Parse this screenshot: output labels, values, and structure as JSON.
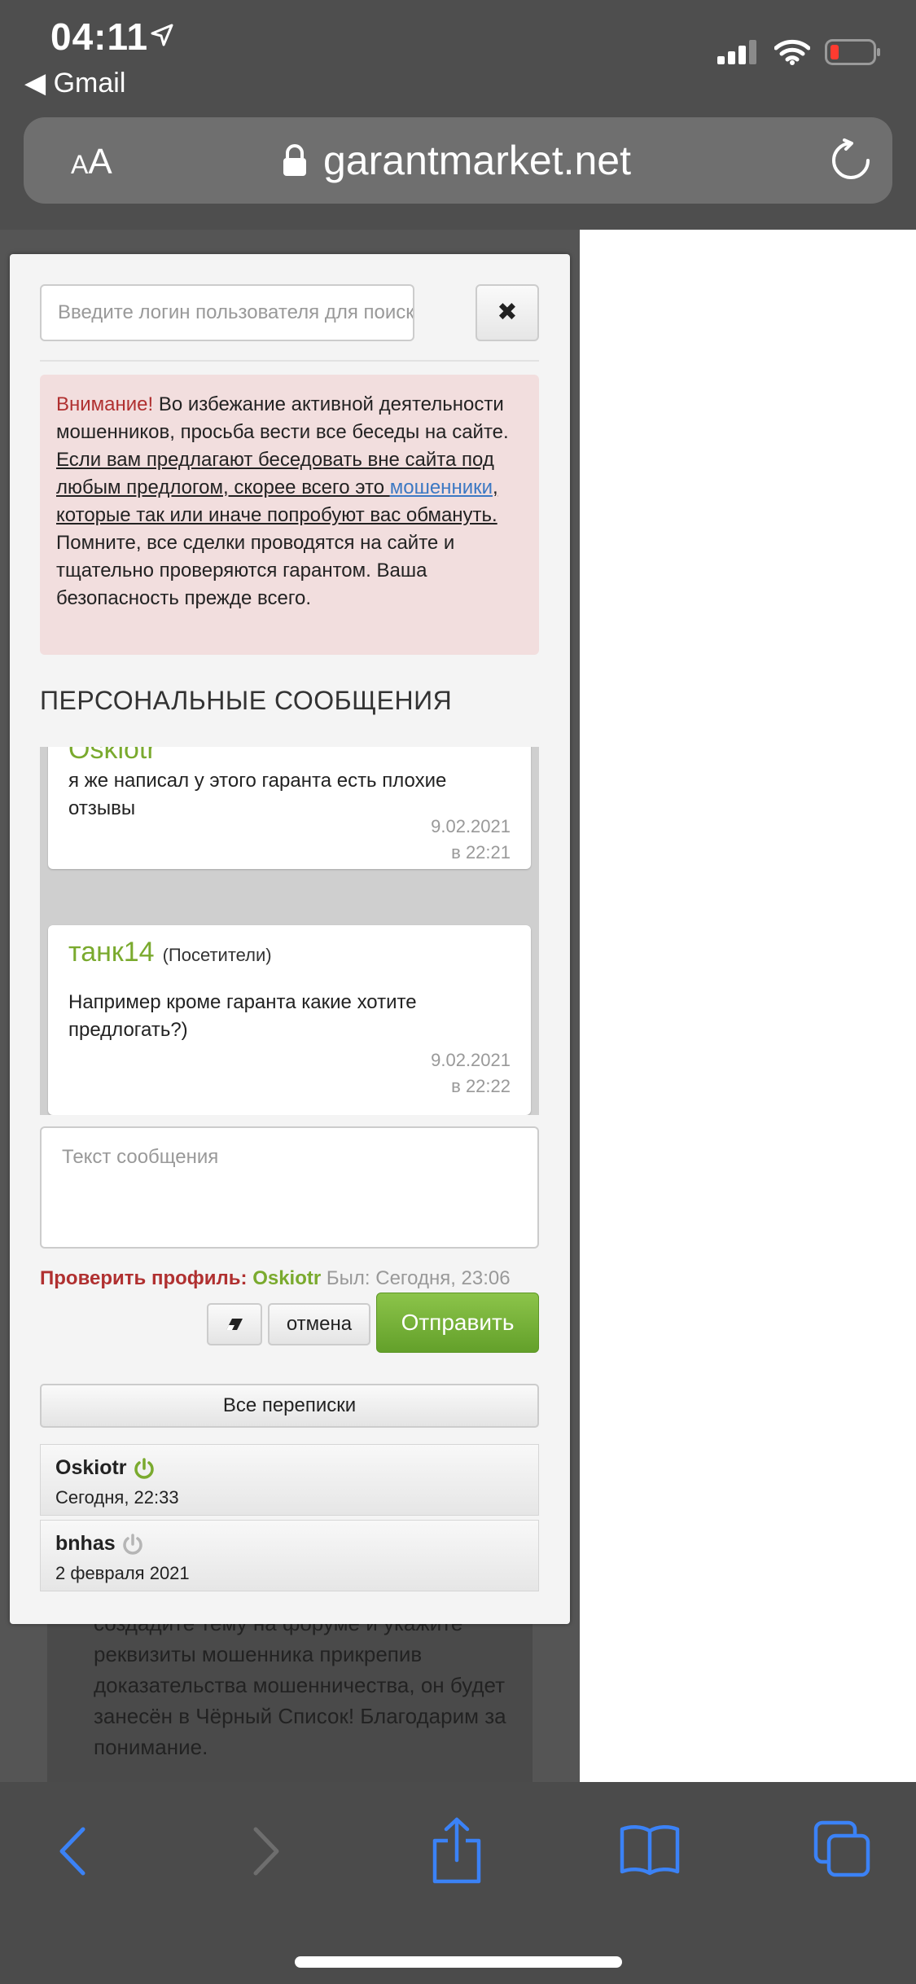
{
  "status_bar": {
    "time": "04:11",
    "back_app": "◀ Gmail"
  },
  "url_bar": {
    "text_size_label": "AA",
    "domain": "garantmarket.net"
  },
  "modal": {
    "search_placeholder": "Введите логин пользователя для поиска",
    "close_label": "✖",
    "alert": {
      "warning_word": "Внимание!",
      "part1": " Во избежание активной деятельности мошенников, просьба вести все беседы на сайте. ",
      "underlined1": "Если вам предлагают беседовать вне сайта под любым предлогом, скорее всего это ",
      "link": "мошенники",
      "underlined2": ", которые так или иначе попробуют вас обмануть.",
      "part2": " Помните, все сделки проводятся на сайте и тщательно проверяются гарантом. Ваша безопасность прежде всего."
    },
    "pm_title": "ПЕРСОНАЛЬНЫЕ СООБЩЕНИЯ",
    "messages": [
      {
        "author": "Oskiotr",
        "text": "я же написал у этого гаранта есть плохие отзывы",
        "date": "9.02.2021",
        "time": "в 22:21"
      },
      {
        "author": "танк14",
        "role": "(Посетители)",
        "text": "Например кроме гаранта какие хотите предлогать?)",
        "date": "9.02.2021",
        "time": "в 22:22"
      }
    ],
    "message_placeholder": "Текст сообщения",
    "profile": {
      "label": "Проверить профиль:",
      "nick": "Oskiotr",
      "seen": "Был: Сегодня, 23:06"
    },
    "buttons": {
      "cancel": "отмена",
      "send": "Отправить",
      "all_chats": "Все переписки"
    },
    "conversations": [
      {
        "name": "Oskiotr",
        "date": "Сегодня, 22:33",
        "online": true
      },
      {
        "name": "bnhas",
        "date": "2 февраля 2021",
        "online": false
      }
    ]
  },
  "background_text": "создадите тему на форуме и укажите реквизиты мошенника прикрепив доказательства мошенничества, он будет занесён в Чёрный Список! Благодарим за понимание.",
  "colors": {
    "accent_green": "#7aaa2e",
    "warning_red": "#b03030",
    "alert_bg": "#f2dede",
    "ios_blue": "#3b82f6"
  }
}
